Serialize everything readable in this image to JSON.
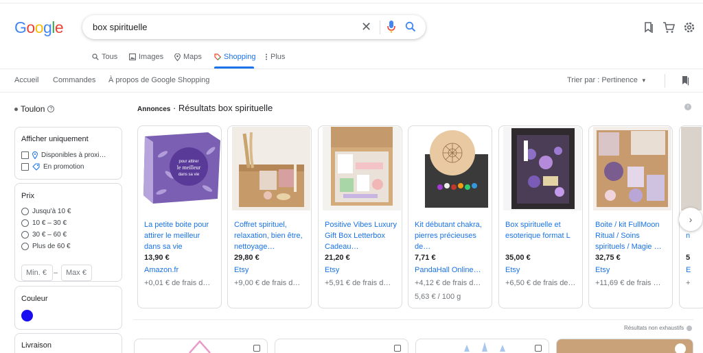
{
  "logo": {
    "text": "Google",
    "colors": [
      "#4285f4",
      "#ea4335",
      "#fbbc05",
      "#4285f4",
      "#34a853",
      "#ea4335"
    ]
  },
  "search": {
    "query": "box spirituelle"
  },
  "header_icons": [
    "bookmark-icon",
    "cart-icon",
    "settings-icon"
  ],
  "tabs": [
    {
      "label": "Tous",
      "icon": "search-icon",
      "active": false
    },
    {
      "label": "Images",
      "icon": "image-icon",
      "active": false
    },
    {
      "label": "Maps",
      "icon": "map-pin-icon",
      "active": false
    },
    {
      "label": "Shopping",
      "icon": "shopping-tag-icon",
      "active": true
    },
    {
      "label": "Plus",
      "icon": "more-vert-icon",
      "active": false
    }
  ],
  "subnav": {
    "items": [
      "Accueil",
      "Commandes",
      "À propos de Google Shopping"
    ],
    "sort_label": "Trier par : Pertinence"
  },
  "sidebar": {
    "location": "Toulon",
    "availability": {
      "title": "Afficher uniquement",
      "options": [
        "Disponibles à proxi…",
        "En promotion"
      ]
    },
    "price": {
      "title": "Prix",
      "options": [
        "Jusqu'à 10 €",
        "10 € – 30 €",
        "30 € – 60 €",
        "Plus de 60 €"
      ],
      "min_placeholder": "Min.  €",
      "max_placeholder": "Max  €"
    },
    "color": {
      "title": "Couleur",
      "swatch": "#1a0df0"
    },
    "delivery": {
      "title": "Livraison"
    }
  },
  "results": {
    "ads_label": "Annonces",
    "title": " · Résultats box spirituelle",
    "non_exhaustive": "Résultats non exhaustifs"
  },
  "products": [
    {
      "title": "La petite boite pour attirer le meilleur dans sa vie",
      "price": "13,90 €",
      "merchant": "Amazon.fr",
      "shipping": "+0,01 € de frais d…",
      "unit": "",
      "image": "purple-box"
    },
    {
      "title": "Coffret spirituel, relaxation, bien être, nettoyage…",
      "price": "29,80 €",
      "merchant": "Etsy",
      "shipping": "+9,00 € de frais d…",
      "unit": "",
      "image": "kraft-box-herbs"
    },
    {
      "title": "Positive Vibes Luxury Gift Box Letterbox Cadeau…",
      "price": "21,20 €",
      "merchant": "Etsy",
      "shipping": "+5,91 € de frais d…",
      "unit": "",
      "image": "letterbox-gift"
    },
    {
      "title": "Kit débutant chakra, pierres précieuses de…",
      "price": "7,71 €",
      "merchant": "PandaHall Online…",
      "shipping": "+4,12 € de frais d…",
      "unit": "5,63 € / 100 g",
      "image": "chakra-kit"
    },
    {
      "title": "Box spirituelle et esoterique format L",
      "price": "35,00 €",
      "merchant": "Etsy",
      "shipping": "+6,50 € de frais de…",
      "unit": "",
      "image": "esoteric-box"
    },
    {
      "title": "Boite / kit FullMoon Ritual / Soins spirituels / Magie …",
      "price": "32,75 €",
      "merchant": "Etsy",
      "shipping": "+11,69 € de frais …",
      "unit": "",
      "image": "fullmoon-kit"
    }
  ],
  "partial_card": {
    "title_fragment": "m",
    "title_fragment2": "n",
    "price_fragment": "5",
    "merchant_fragment": "E",
    "shipping_fragment": "+"
  },
  "next_button_icon": "chevron-right-icon"
}
